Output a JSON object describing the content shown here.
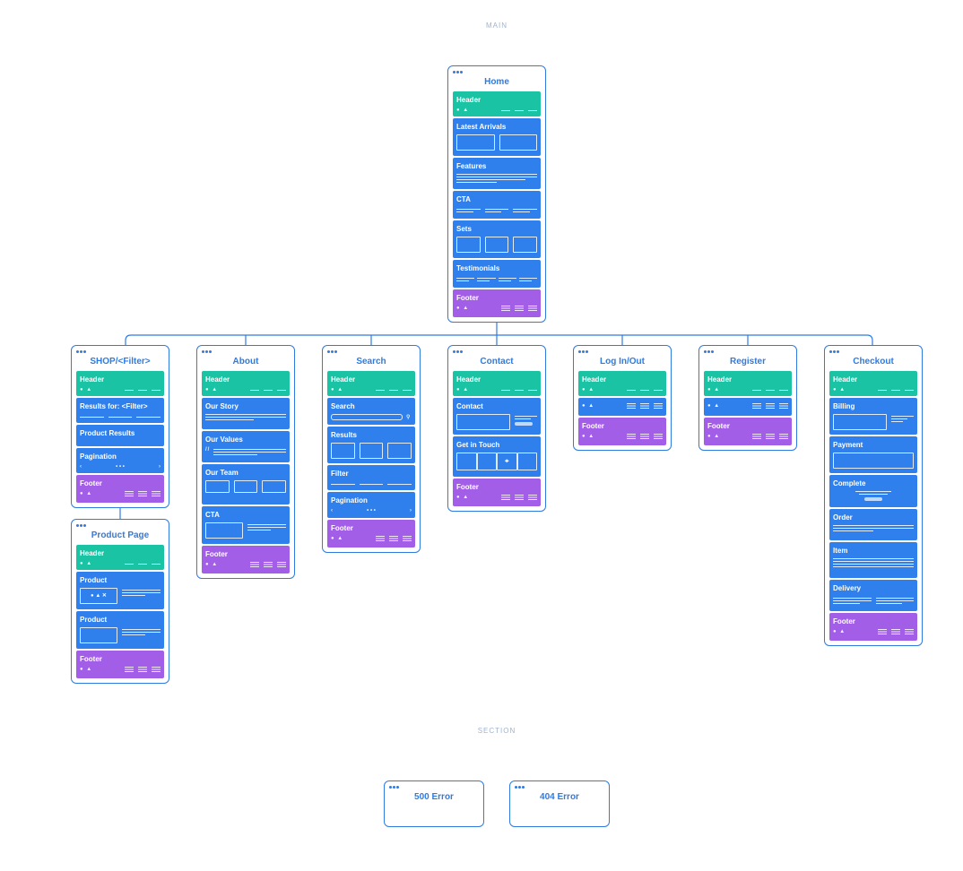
{
  "sections": {
    "main": "MAIN",
    "section": "SECTION"
  },
  "colors": {
    "card_border": "#2f7be0",
    "content_block": "#2f80ed",
    "header_block": "#19c3a3",
    "footer_block": "#a35ee8"
  },
  "icons": {
    "window_dots": "three-dots-icon",
    "search": "search-icon",
    "map_pin": "map-pin-icon",
    "quote": "quote-icon"
  },
  "home": {
    "title": "Home",
    "blocks": [
      "Header",
      "Latest Arrivals",
      "Features",
      "CTA",
      "Sets",
      "Testimonials",
      "Footer"
    ]
  },
  "shop": {
    "title": "SHOP/<Filter>",
    "blocks": [
      "Header",
      "Results for: <Filter>",
      "Product Results",
      "Pagination",
      "Footer"
    ]
  },
  "product_page": {
    "title": "Product Page",
    "blocks": [
      "Header",
      "Product",
      "Product",
      "Footer"
    ]
  },
  "about": {
    "title": "About",
    "blocks": [
      "Header",
      "Our Story",
      "Our Values",
      "Our Team",
      "CTA",
      "Footer"
    ]
  },
  "search": {
    "title": "Search",
    "blocks": [
      "Header",
      "Search",
      "Results",
      "Filter",
      "Pagination",
      "Footer"
    ]
  },
  "contact": {
    "title": "Contact",
    "blocks": [
      "Header",
      "Contact",
      "Get in Touch",
      "Footer"
    ]
  },
  "login": {
    "title": "Log In/Out",
    "blocks": [
      "Header",
      "Footer"
    ]
  },
  "register": {
    "title": "Register",
    "blocks": [
      "Header",
      "Footer"
    ]
  },
  "checkout": {
    "title": "Checkout",
    "blocks": [
      "Header",
      "Billing",
      "Payment",
      "Complete",
      "Order",
      "Item",
      "Delivery",
      "Footer"
    ]
  },
  "errors": {
    "e500": "500 Error",
    "e404": "404 Error"
  },
  "decor": {
    "header_dots": "● ▲",
    "pager": "‹  • • •  ›",
    "pager_left": "‹",
    "pager_mid": "• • •",
    "pager_right": "›",
    "quote_mark": "//",
    "product_shapes": "● ▲ ✕"
  }
}
